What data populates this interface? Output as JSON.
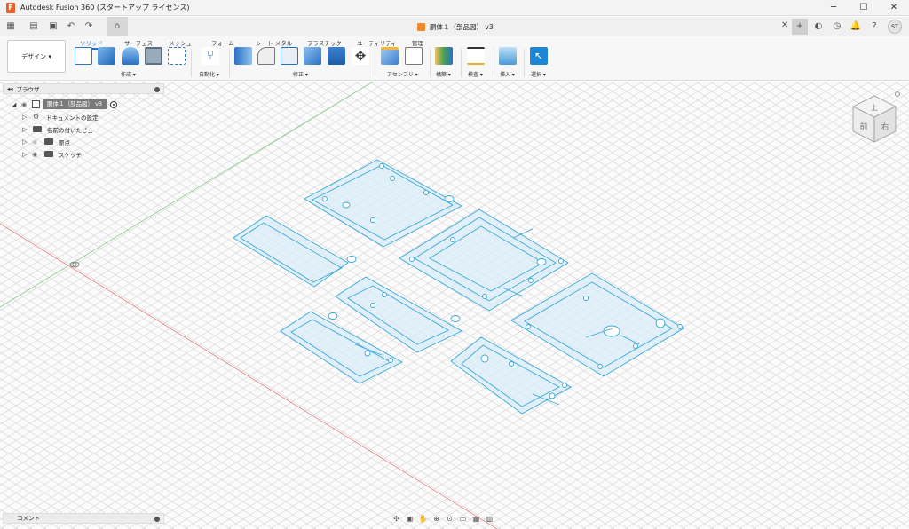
{
  "titlebar": {
    "app_title": "Autodesk Fusion 360 (スタートアップ ライセンス)",
    "minimize": "─",
    "maximize": "☐",
    "close": "✕"
  },
  "tabbar": {
    "document_tab": "胴体１（部品図） v3",
    "user_initials": "ST"
  },
  "ribbon": {
    "workspace": "デザイン ▾",
    "tabs": [
      "ソリッド",
      "サーフェス",
      "メッシュ",
      "フォーム",
      "シート メタル",
      "プラスチック",
      "ユーティリティ",
      "管理"
    ],
    "groups": [
      "作成 ▾",
      "自動化 ▾",
      "修正 ▾",
      "アセンブリ ▾",
      "構築 ▾",
      "検査 ▾",
      "挿入 ▾",
      "選択 ▾"
    ]
  },
  "browser": {
    "title": "ブラウザ",
    "root": "胴体１（部品図） v3",
    "items": [
      "ドキュメントの設定",
      "名前の付いたビュー",
      "原点",
      "スケッチ"
    ]
  },
  "comments": {
    "title": "コメント"
  },
  "viewcube": {
    "front": "前",
    "right": "右",
    "top": "上"
  },
  "colors": {
    "accent": "#1a6fd0",
    "sketch": "#39a7d8",
    "sketch_fill": "#d9eef8"
  }
}
